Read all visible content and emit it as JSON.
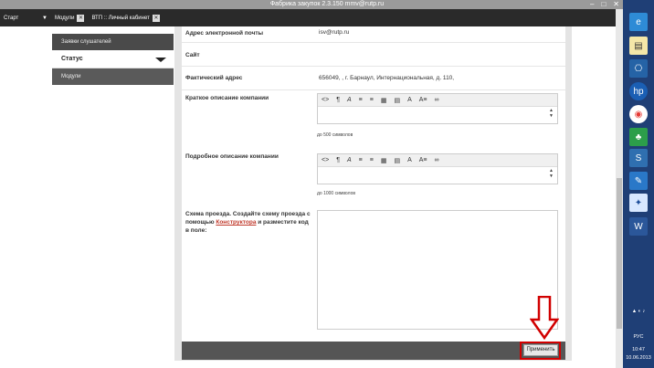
{
  "window": {
    "title": "Фабрика закупок 2.3.150 mmv@rutp.ru"
  },
  "menubar": {
    "start": "Старт",
    "tabs": [
      {
        "label": "Модули"
      },
      {
        "label": "ВТП :: Личный кабинет"
      }
    ]
  },
  "sidebar": {
    "items": [
      {
        "label": "Заявки слушателей"
      },
      {
        "label": "Статус"
      },
      {
        "label": "Модули"
      }
    ]
  },
  "form": {
    "email_label": "Адрес электронной почты",
    "email_value": "isv@rutp.ru",
    "site_label": "Сайт",
    "address_label": "Фактический адрес",
    "address_value": "656049,   ,  г. Барнаул,  Интернациональная,  д. 110,",
    "short_label": "Краткое описание компании",
    "short_hint": "до 500 символов",
    "long_label": "Подробное описание компании",
    "long_hint": "до 1000 символов",
    "scheme_label_pre": "Схема проезда. Создайте схему проезда с помощью",
    "scheme_link": "Конструктора",
    "scheme_label_post": "и разместите код в поле:",
    "apply_button": "Применить"
  },
  "toolbar_icons": [
    "<>",
    "¶",
    "A",
    "≡",
    "≡",
    "▦",
    "▤",
    "A",
    "A≡",
    "∞"
  ],
  "taskbar": {
    "lang": "РУС",
    "time": "10:47",
    "date": "10.06.2013"
  },
  "colors": {
    "accent_red": "#d10000",
    "link_red": "#c0392b",
    "taskbar_blue": "#1f3f76"
  }
}
